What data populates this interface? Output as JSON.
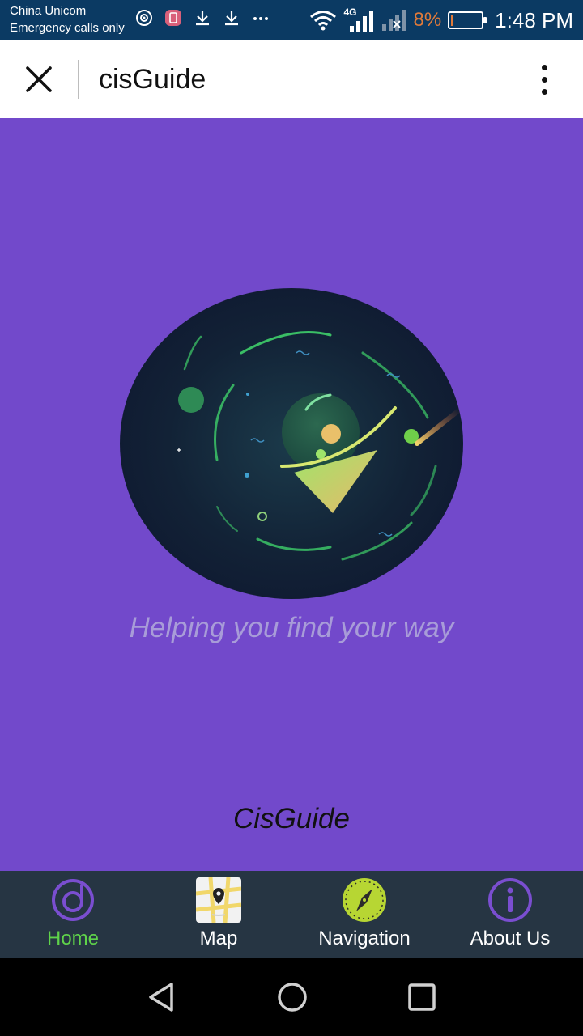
{
  "status_bar": {
    "carrier_line1": "China Unicom",
    "carrier_line2": "Emergency calls only",
    "network_label": "4G",
    "battery_percent": "8%",
    "battery_level": 0.08,
    "time": "1:48 PM"
  },
  "app_bar": {
    "title": "cisGuide",
    "close_icon": "close-icon",
    "menu_icon": "more-vert-icon"
  },
  "main": {
    "background": "#7249cb",
    "tagline": "Helping you find your way",
    "app_name": "CisGuide"
  },
  "bottom_nav": {
    "items": [
      {
        "label": "Home",
        "icon": "home-ring-icon",
        "active": true
      },
      {
        "label": "Map",
        "icon": "map-icon",
        "active": false
      },
      {
        "label": "Navigation",
        "icon": "compass-icon",
        "active": false
      },
      {
        "label": "About Us",
        "icon": "info-icon",
        "active": false
      }
    ],
    "active_color": "#5fd34a"
  },
  "system_nav": {
    "back": "back-icon",
    "home": "home-circle-icon",
    "recents": "recents-icon"
  }
}
